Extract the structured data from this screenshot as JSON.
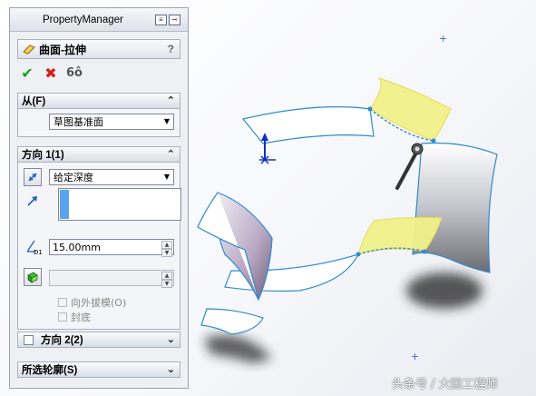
{
  "panel": {
    "title": "PropertyManager",
    "feature_title": "曲面-拉伸",
    "help": "?",
    "icons": {
      "feature": "surface-extrude-icon",
      "ok": "check-icon",
      "cancel": "close-icon",
      "detail": "glasses-icon"
    }
  },
  "from": {
    "header": "从(F)",
    "start_condition": "草图基准面"
  },
  "direction1": {
    "header": "方向 1(1)",
    "end_condition": "给定深度",
    "depth": "15.00mm",
    "draft_outward": "向外拔模(O)",
    "cap_end": "封底"
  },
  "direction2": {
    "header": "方向 2(2)"
  },
  "contours": {
    "header": "所选轮廓(S)"
  },
  "watermark": "头条号 / 大国工程师",
  "colors": {
    "edge": "#2f8bd0",
    "highlight": "#f1f18a",
    "selection": "#5aa3ef"
  }
}
